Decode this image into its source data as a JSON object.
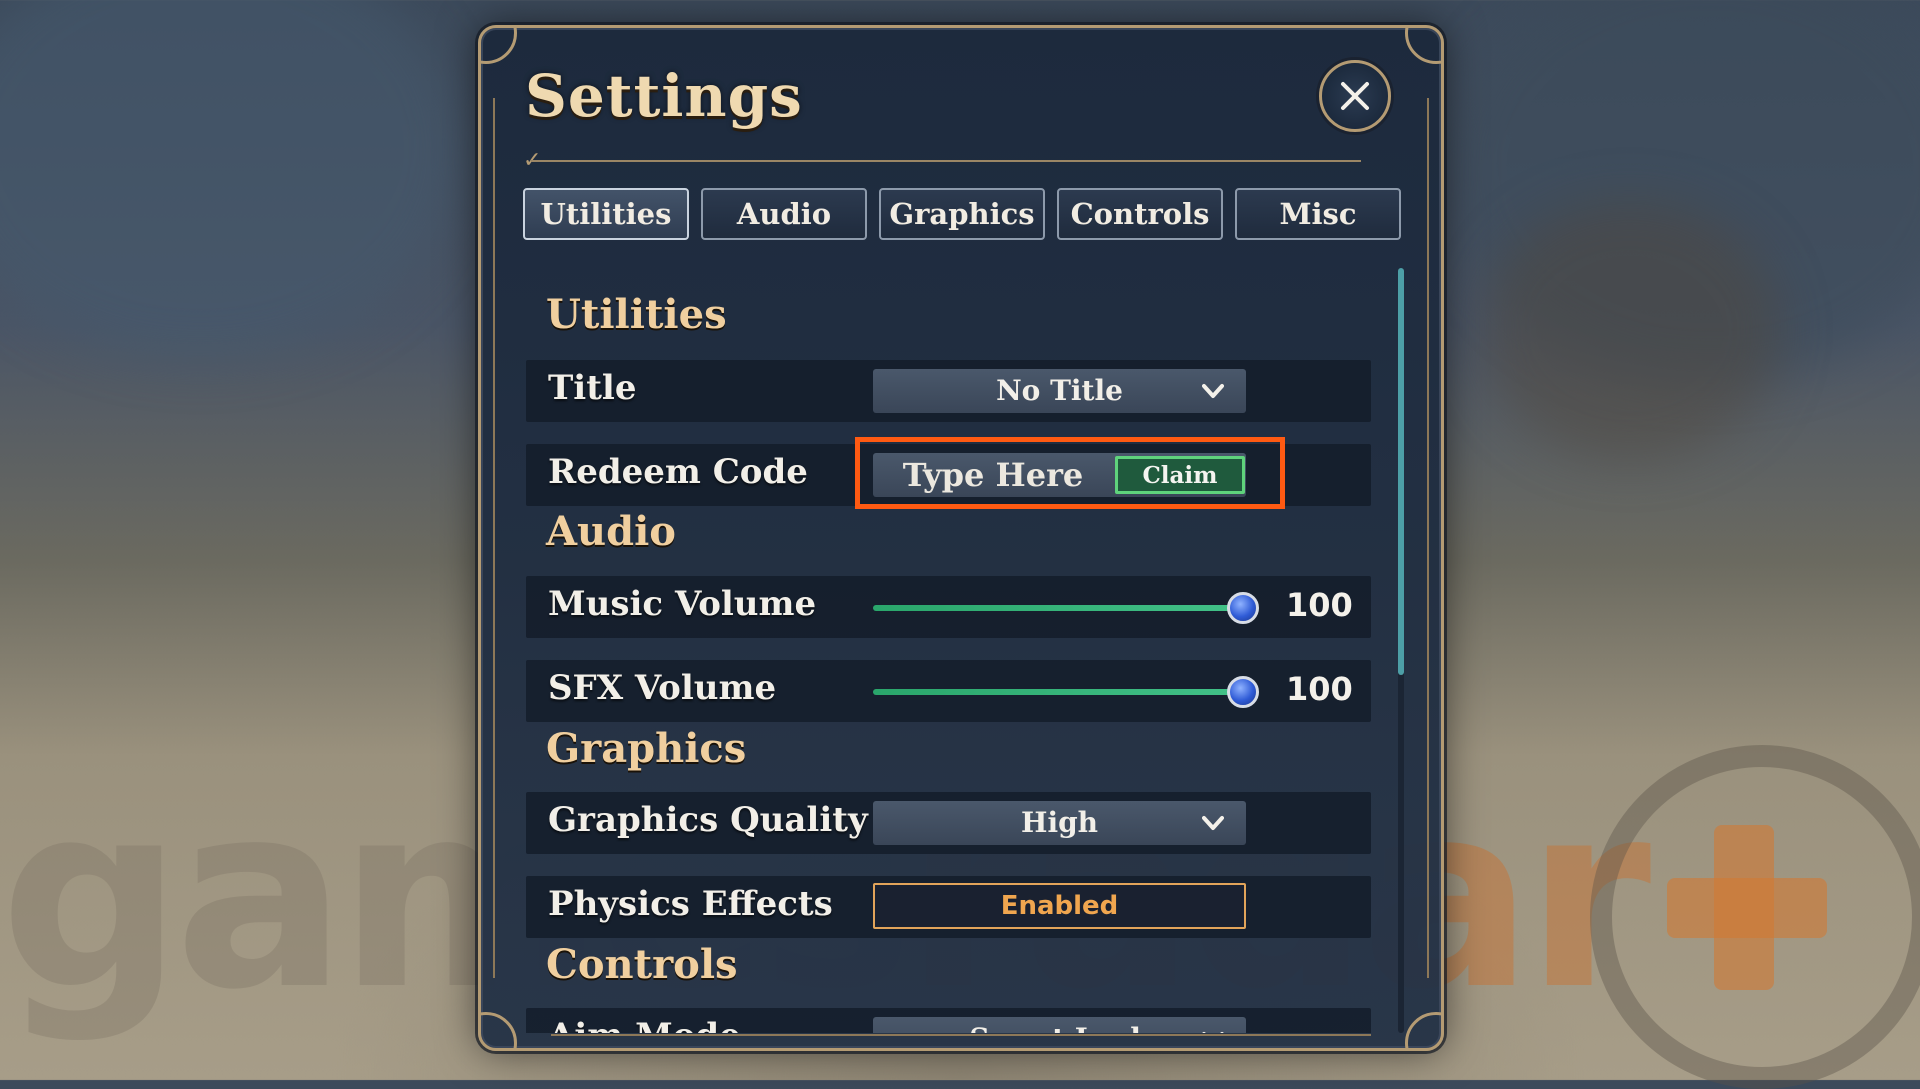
{
  "window": {
    "title": "Settings"
  },
  "tabs": [
    {
      "label": "Utilities",
      "active": true
    },
    {
      "label": "Audio",
      "active": false
    },
    {
      "label": "Graphics",
      "active": false
    },
    {
      "label": "Controls",
      "active": false
    },
    {
      "label": "Misc",
      "active": false
    }
  ],
  "sections": {
    "utilities": {
      "heading": "Utilities",
      "title_row": {
        "label": "Title",
        "value": "No Title"
      },
      "redeem_row": {
        "label": "Redeem Code",
        "placeholder": "Type Here",
        "button_label": "Claim"
      }
    },
    "audio": {
      "heading": "Audio",
      "music": {
        "label": "Music Volume",
        "value": "100",
        "level": 1.0
      },
      "sfx": {
        "label": "SFX Volume",
        "value": "100",
        "level": 1.0
      }
    },
    "graphics": {
      "heading": "Graphics",
      "quality": {
        "label": "Graphics Quality",
        "value": "High"
      },
      "physics": {
        "label": "Physics Effects",
        "value": "Enabled"
      }
    },
    "controls": {
      "heading": "Controls",
      "aim": {
        "label": "Aim Mode",
        "value": "Smart Lock"
      }
    }
  },
  "watermark": {
    "word_a": "games",
    "word_b": "radar"
  },
  "colors": {
    "accent_gold": "#f0cf9f",
    "highlight_orange": "#ff5a12",
    "slider_green": "#42c188",
    "claim_green": "#5fd37c",
    "toggle_orange": "#f0a64f"
  },
  "icons": {
    "close": "close-icon",
    "dropdown": "chevron-down-icon",
    "slider_knob": "slider-knob"
  }
}
